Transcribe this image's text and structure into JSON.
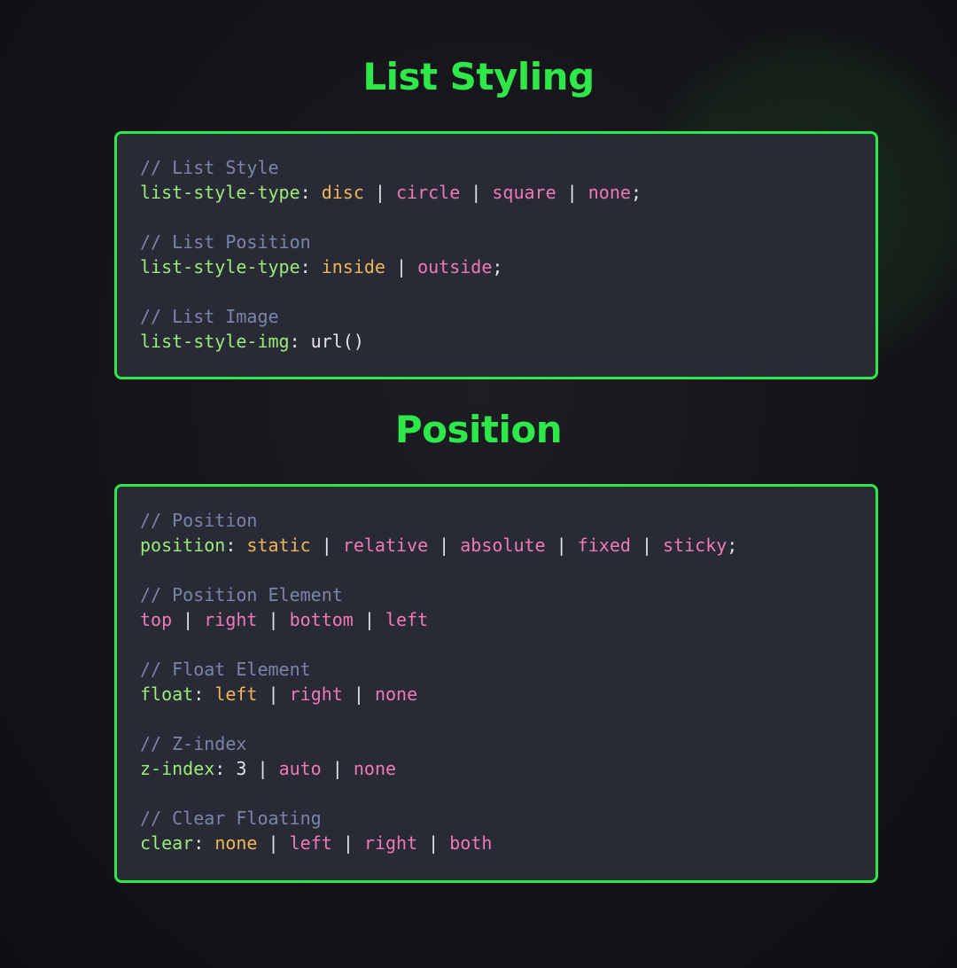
{
  "colors": {
    "accent": "#2ee84a",
    "background": "#15151a",
    "box_bg": "#282a35",
    "comment": "#7b85a8",
    "property": "#9cec7a",
    "value_orange": "#f0b657",
    "value_pink": "#f07ab2"
  },
  "sections": [
    {
      "title": "List Styling",
      "blocks": [
        {
          "comment": "// List Style",
          "tokens": [
            {
              "t": "list-style-type",
              "c": "prop"
            },
            {
              "t": ": ",
              "c": "plain"
            },
            {
              "t": "disc",
              "c": "val-orange"
            },
            {
              "t": " | ",
              "c": "sep"
            },
            {
              "t": "circle",
              "c": "val-pink"
            },
            {
              "t": " | ",
              "c": "sep"
            },
            {
              "t": "square",
              "c": "val-pink"
            },
            {
              "t": " | ",
              "c": "sep"
            },
            {
              "t": "none",
              "c": "val-pink"
            },
            {
              "t": ";",
              "c": "plain"
            }
          ]
        },
        {
          "comment": "// List Position",
          "tokens": [
            {
              "t": "list-style-type",
              "c": "prop"
            },
            {
              "t": ": ",
              "c": "plain"
            },
            {
              "t": "inside",
              "c": "val-orange"
            },
            {
              "t": " | ",
              "c": "sep"
            },
            {
              "t": "outside",
              "c": "val-pink"
            },
            {
              "t": ";",
              "c": "plain"
            }
          ]
        },
        {
          "comment": "// List Image",
          "tokens": [
            {
              "t": "list-style-img",
              "c": "prop"
            },
            {
              "t": ": ",
              "c": "plain"
            },
            {
              "t": "url()",
              "c": "plain"
            }
          ]
        }
      ]
    },
    {
      "title": "Position",
      "blocks": [
        {
          "comment": "// Position",
          "tokens": [
            {
              "t": "position",
              "c": "prop"
            },
            {
              "t": ": ",
              "c": "plain"
            },
            {
              "t": "static",
              "c": "val-orange"
            },
            {
              "t": " | ",
              "c": "sep"
            },
            {
              "t": "relative",
              "c": "val-pink"
            },
            {
              "t": " | ",
              "c": "sep"
            },
            {
              "t": "absolute",
              "c": "val-pink"
            },
            {
              "t": " | ",
              "c": "sep"
            },
            {
              "t": "fixed",
              "c": "val-pink"
            },
            {
              "t": " | ",
              "c": "sep"
            },
            {
              "t": "sticky",
              "c": "val-pink"
            },
            {
              "t": ";",
              "c": "plain"
            }
          ]
        },
        {
          "comment": "// Position Element",
          "tokens": [
            {
              "t": "top",
              "c": "val-pink"
            },
            {
              "t": " | ",
              "c": "sep"
            },
            {
              "t": "right",
              "c": "val-pink"
            },
            {
              "t": " | ",
              "c": "sep"
            },
            {
              "t": "bottom",
              "c": "val-pink"
            },
            {
              "t": " | ",
              "c": "sep"
            },
            {
              "t": "left",
              "c": "val-pink"
            }
          ]
        },
        {
          "comment": "// Float Element",
          "tokens": [
            {
              "t": "float",
              "c": "prop"
            },
            {
              "t": ": ",
              "c": "plain"
            },
            {
              "t": "left",
              "c": "val-orange"
            },
            {
              "t": " | ",
              "c": "sep"
            },
            {
              "t": "right",
              "c": "val-pink"
            },
            {
              "t": " | ",
              "c": "sep"
            },
            {
              "t": "none",
              "c": "val-pink"
            }
          ]
        },
        {
          "comment": "// Z-index",
          "tokens": [
            {
              "t": "z-index",
              "c": "prop"
            },
            {
              "t": ": ",
              "c": "plain"
            },
            {
              "t": "3",
              "c": "plain"
            },
            {
              "t": " | ",
              "c": "sep"
            },
            {
              "t": "auto",
              "c": "val-pink"
            },
            {
              "t": " | ",
              "c": "sep"
            },
            {
              "t": "none",
              "c": "val-pink"
            }
          ]
        },
        {
          "comment": "// Clear Floating",
          "tokens": [
            {
              "t": "clear",
              "c": "prop"
            },
            {
              "t": ": ",
              "c": "plain"
            },
            {
              "t": "none",
              "c": "val-orange"
            },
            {
              "t": " | ",
              "c": "sep"
            },
            {
              "t": "left",
              "c": "val-pink"
            },
            {
              "t": " | ",
              "c": "sep"
            },
            {
              "t": "right",
              "c": "val-pink"
            },
            {
              "t": " | ",
              "c": "sep"
            },
            {
              "t": "both",
              "c": "val-pink"
            }
          ]
        }
      ]
    }
  ]
}
